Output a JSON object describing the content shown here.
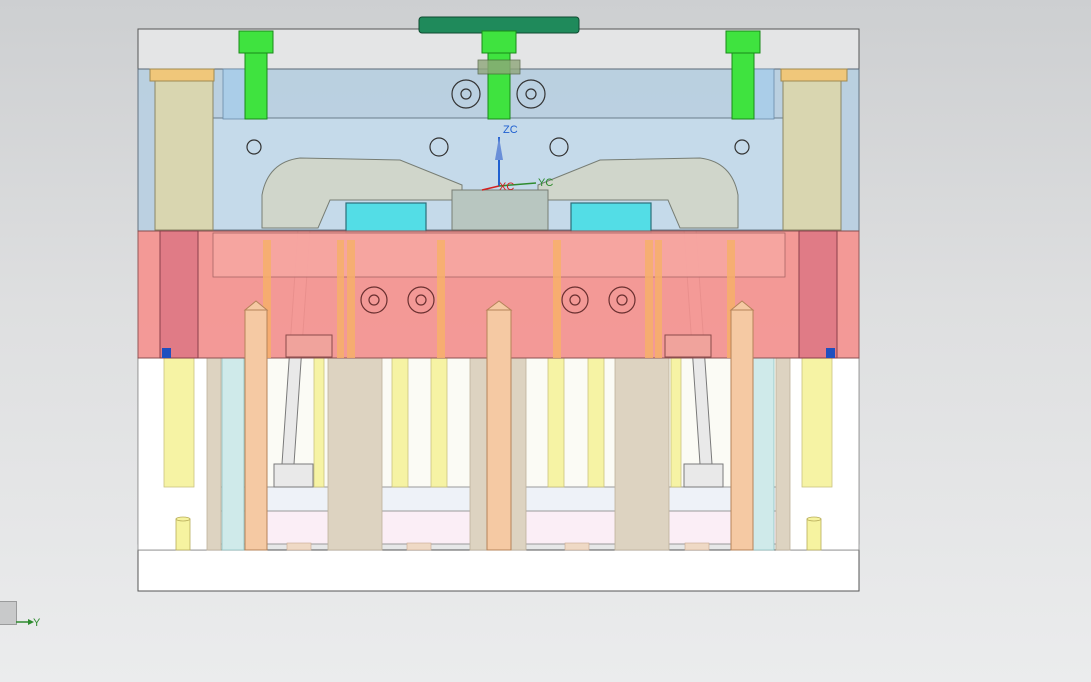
{
  "view": {
    "background_top": "#cdcfd1",
    "background_bottom": "#ebeced",
    "wcs_labels": {
      "zc": "ZC",
      "xc": "XC",
      "yc": "YC"
    },
    "triad_labels": {
      "y": "Y"
    },
    "colors": {
      "top_clamp_plate": "#e4e5e6",
      "cavity_plate": "#b9d0e2",
      "core_plate": "#f49a98",
      "spacer_block": "#fbfbf5",
      "ejector_retainer": "#eef2f8",
      "ejector_plate": "#fbeef6",
      "bottom_clamp_plate": "#ffffff",
      "sprue_bushing": "#3fe33f",
      "locating_ring": "#1f8a5b",
      "guide_pillar": "#d9d6b0",
      "return_pin": "#f5c9a3",
      "slider": "#53dde6",
      "support_pillar": "#f6f3a0",
      "axis_x": "#d42020",
      "axis_y": "#2e8b2e",
      "axis_z": "#2060d0"
    },
    "icons": [
      "wcs-triad-icon",
      "view-triad-icon"
    ]
  }
}
